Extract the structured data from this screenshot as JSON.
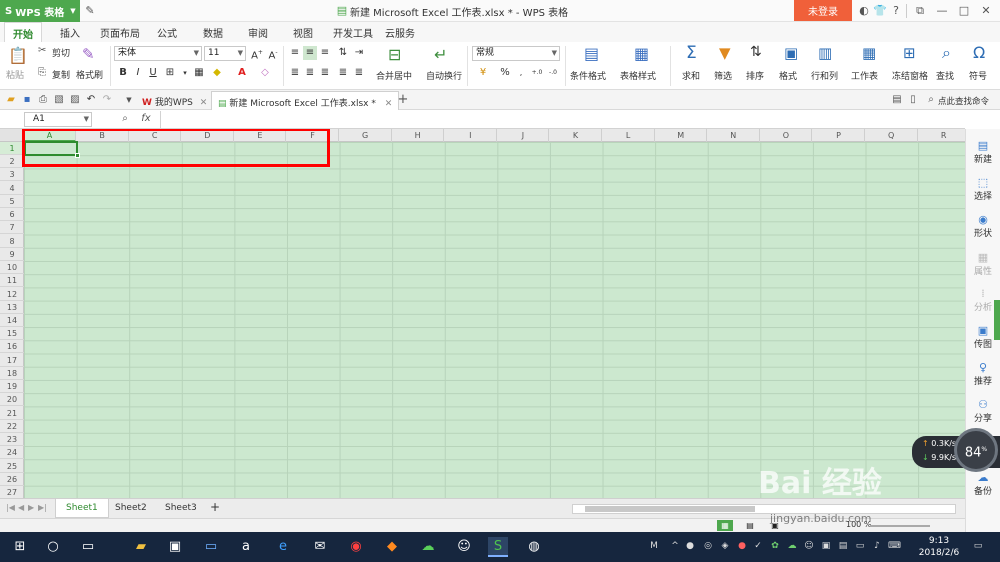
{
  "app": {
    "name": "WPS 表格",
    "doc_title": "新建 Microsoft Excel 工作表.xlsx * - WPS 表格",
    "login": "未登录"
  },
  "menu": [
    "开始",
    "插入",
    "页面布局",
    "公式",
    "数据",
    "审阅",
    "视图",
    "开发工具",
    "云服务"
  ],
  "ribbon": {
    "paste": "粘贴",
    "cut": "剪切",
    "copy": "复制",
    "format_painter": "格式刷",
    "font_name": "宋体",
    "font_size": "11",
    "merge_center": "合并居中",
    "wrap_text": "自动换行",
    "number_format": "常规",
    "conditional_format": "条件格式",
    "table_style": "表格样式",
    "sum": "求和",
    "filter": "筛选",
    "sort": "排序",
    "format": "格式",
    "row_col": "行和列",
    "worksheet": "工作表",
    "freeze": "冻结窗格",
    "find": "查找",
    "symbol": "符号"
  },
  "doc_tabs": {
    "home": "我的WPS",
    "file": "新建 Microsoft Excel 工作表.xlsx *",
    "search_cmd": "点此查找命令"
  },
  "formula": {
    "name_box": "A1",
    "fx": "fx"
  },
  "columns": [
    "A",
    "B",
    "C",
    "D",
    "E",
    "F",
    "G",
    "H",
    "I",
    "J",
    "K",
    "L",
    "M",
    "N",
    "O",
    "P",
    "Q",
    "R"
  ],
  "rows": [
    "1",
    "2",
    "3",
    "4",
    "5",
    "6",
    "7",
    "8",
    "9",
    "10",
    "11",
    "12",
    "13",
    "14",
    "15",
    "16",
    "17",
    "18",
    "19",
    "20",
    "21",
    "22",
    "23",
    "24",
    "25",
    "26",
    "27"
  ],
  "selected_cell": {
    "col": "A",
    "row": "1"
  },
  "right_panel": [
    {
      "label": "新建",
      "enabled": true
    },
    {
      "label": "选择",
      "enabled": true
    },
    {
      "label": "形状",
      "enabled": true
    },
    {
      "label": "属性",
      "enabled": false
    },
    {
      "label": "分析",
      "enabled": false
    },
    {
      "label": "传图",
      "enabled": true
    },
    {
      "label": "推荐",
      "enabled": true
    },
    {
      "label": "分享",
      "enabled": true
    },
    {
      "label": "备份",
      "enabled": true
    }
  ],
  "network": {
    "up": "0.3K/s",
    "down": "9.9K/s",
    "usage": "84",
    "usage_unit": "%"
  },
  "sheets": [
    "Sheet1",
    "Sheet2",
    "Sheet3"
  ],
  "active_sheet": "Sheet1",
  "status": {
    "zoom": "100 %"
  },
  "clock": {
    "time": "9:13",
    "date": "2018/2/6"
  },
  "watermark": {
    "text": "Bai 经验",
    "url": "jingyan.baidu.com"
  },
  "colors": {
    "accent": "#4ea84e",
    "login": "#f0603a",
    "grid_bg": "#cce8cf",
    "highlight": "#ff0000",
    "taskbar": "#16263e"
  }
}
